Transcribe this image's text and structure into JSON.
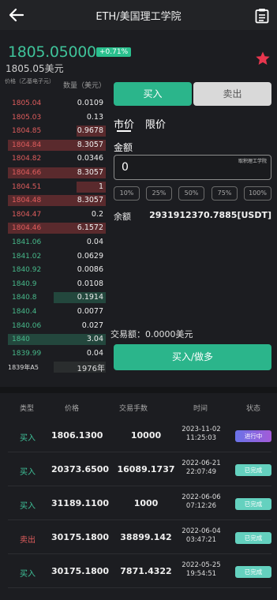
{
  "header": {
    "title": "ETH/美国理工学院"
  },
  "ticker": {
    "price": "1805.05000",
    "change": "+0.71%",
    "price_usd": "1805.05美元"
  },
  "orderbook": {
    "price_header": "价格（乙基电子元）",
    "qty_header": "数量（美元）",
    "asks": [
      {
        "price": "1805.04",
        "qty": "0.0109",
        "fill": 0.0
      },
      {
        "price": "1805.03",
        "qty": "0.13",
        "fill": 0.0
      },
      {
        "price": "1804.85",
        "qty": "0.9678",
        "fill": 0.3
      },
      {
        "price": "1804.84",
        "qty": "8.3057",
        "fill": 1.0
      },
      {
        "price": "1804.82",
        "qty": "0.0346",
        "fill": 0.0
      },
      {
        "price": "1804.66",
        "qty": "8.3057",
        "fill": 1.0
      },
      {
        "price": "1804.51",
        "qty": "1",
        "fill": 0.3
      },
      {
        "price": "1804.48",
        "qty": "8.3057",
        "fill": 1.0
      },
      {
        "price": "1804.47",
        "qty": "0.2",
        "fill": 0.0
      },
      {
        "price": "1804.46",
        "qty": "6.1572",
        "fill": 1.0
      }
    ],
    "bids": [
      {
        "price": "1841.06",
        "qty": "0.04",
        "fill": 0.0
      },
      {
        "price": "1841.02",
        "qty": "0.0629",
        "fill": 0.0
      },
      {
        "price": "1840.92",
        "qty": "0.0086",
        "fill": 0.0
      },
      {
        "price": "1840.9",
        "qty": "0.0108",
        "fill": 0.0
      },
      {
        "price": "1840.8",
        "qty": "0.1914",
        "fill": 0.53
      },
      {
        "price": "1840.4",
        "qty": "0.0077",
        "fill": 0.0
      },
      {
        "price": "1840.06",
        "qty": "0.027",
        "fill": 0.0
      },
      {
        "price": "1840",
        "qty": "3.04",
        "fill": 1.0
      },
      {
        "price": "1839.99",
        "qty": "0.04",
        "fill": 0.0
      }
    ],
    "footer_left": "1839年A5",
    "footer_right": "1976年"
  },
  "trade": {
    "buy_tab": "买入",
    "sell_tab": "卖出",
    "market_tab": "市价",
    "limit_tab": "限价",
    "amount_label": "金额",
    "amount_value": "0",
    "amount_unit": "取积理工学院",
    "percents": [
      "10%",
      "25%",
      "50%",
      "75%",
      "100%"
    ],
    "balance_label": "余额",
    "balance_value": "2931912370.7885[USDT]",
    "trade_amount": "交易额：0.0000美元",
    "submit_label": "买入/做多"
  },
  "history": {
    "headers": [
      "类型",
      "价格",
      "交易手数",
      "时间",
      "状态"
    ],
    "rows": [
      {
        "type": "买入",
        "side": "buy",
        "price": "1806.1300",
        "amount": "10000",
        "date": "2023-11-02",
        "time": "11:25:03",
        "status": "进行中",
        "status_kind": "run"
      },
      {
        "type": "买入",
        "side": "buy",
        "price": "20373.6500",
        "amount": "16089.1737",
        "date": "2022-06-21",
        "time": "22:07:49",
        "status": "已完成",
        "status_kind": "done"
      },
      {
        "type": "买入",
        "side": "buy",
        "price": "31189.1100",
        "amount": "1000",
        "date": "2022-06-06",
        "time": "07:12:26",
        "status": "已完成",
        "status_kind": "done"
      },
      {
        "type": "卖出",
        "side": "sell",
        "price": "30175.1800",
        "amount": "38899.142",
        "date": "2022-06-04",
        "time": "03:47:21",
        "status": "已完成",
        "status_kind": "done"
      },
      {
        "type": "买入",
        "side": "buy",
        "price": "30175.1800",
        "amount": "7871.4322",
        "date": "2022-05-25",
        "time": "19:54:51",
        "status": "已完成",
        "status_kind": "done"
      }
    ]
  }
}
